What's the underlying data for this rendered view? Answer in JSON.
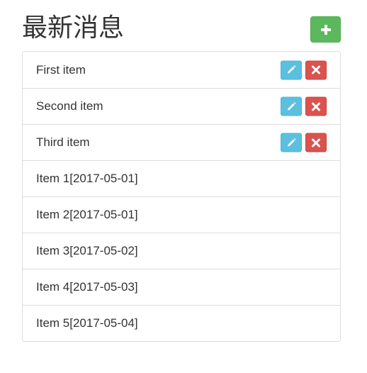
{
  "header": {
    "title": "最新消息",
    "add_icon": "plus-icon"
  },
  "colors": {
    "add_button": "#5cb85c",
    "edit_button": "#5bc0de",
    "delete_button": "#d9534f",
    "border": "#dddddd"
  },
  "list": {
    "items": [
      {
        "label": "First item",
        "has_actions": true,
        "edit_icon": "pencil-icon",
        "delete_icon": "close-icon"
      },
      {
        "label": "Second item",
        "has_actions": true,
        "edit_icon": "pencil-icon",
        "delete_icon": "close-icon"
      },
      {
        "label": "Third item",
        "has_actions": true,
        "edit_icon": "pencil-icon",
        "delete_icon": "close-icon"
      },
      {
        "label": "Item 1[2017-05-01]",
        "has_actions": false
      },
      {
        "label": "Item 2[2017-05-01]",
        "has_actions": false
      },
      {
        "label": "Item 3[2017-05-02]",
        "has_actions": false
      },
      {
        "label": "Item 4[2017-05-03]",
        "has_actions": false
      },
      {
        "label": "Item 5[2017-05-04]",
        "has_actions": false
      }
    ]
  }
}
